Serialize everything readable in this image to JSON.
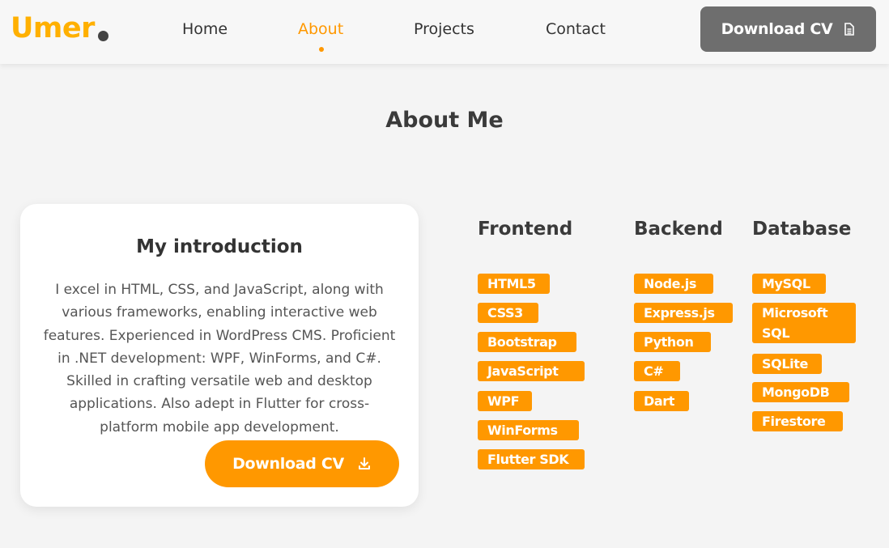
{
  "brand": {
    "name": "Umer"
  },
  "nav": {
    "links": [
      "Home",
      "About",
      "Projects",
      "Contact"
    ],
    "active": "About",
    "cv_label": "Download CV"
  },
  "page_title": "About Me",
  "intro": {
    "title": "My introduction",
    "text": "I excel in HTML, CSS, and JavaScript, along with various frameworks, enabling interactive web features. Experienced in WordPress CMS. Proficient in .NET development: WPF, WinForms, and C#. Skilled in crafting versatile web and desktop applications. Also adept in Flutter for cross-platform mobile app development.",
    "cv_label": "Download CV"
  },
  "skills": {
    "frontend": {
      "title": "Frontend",
      "items": [
        "HTML5",
        "CSS3",
        "Bootstrap",
        "JavaScript",
        "WPF",
        "WinForms",
        "Flutter SDK"
      ]
    },
    "backend": {
      "title": "Backend",
      "items": [
        "Node.js",
        "Express.js",
        "Python",
        "C#",
        "Dart"
      ]
    },
    "database": {
      "title": "Database",
      "items": [
        "MySQL",
        "Microsoft SQL",
        "SQLite",
        "MongoDB",
        "Firestore"
      ]
    }
  },
  "colors": {
    "accent": "#ff9800",
    "logo": "#ffb000",
    "nav_button": "#6e6e6e",
    "background": "#f4f4f4"
  },
  "icons": {
    "nav_cv": "document-icon",
    "intro_cv": "download-icon"
  }
}
